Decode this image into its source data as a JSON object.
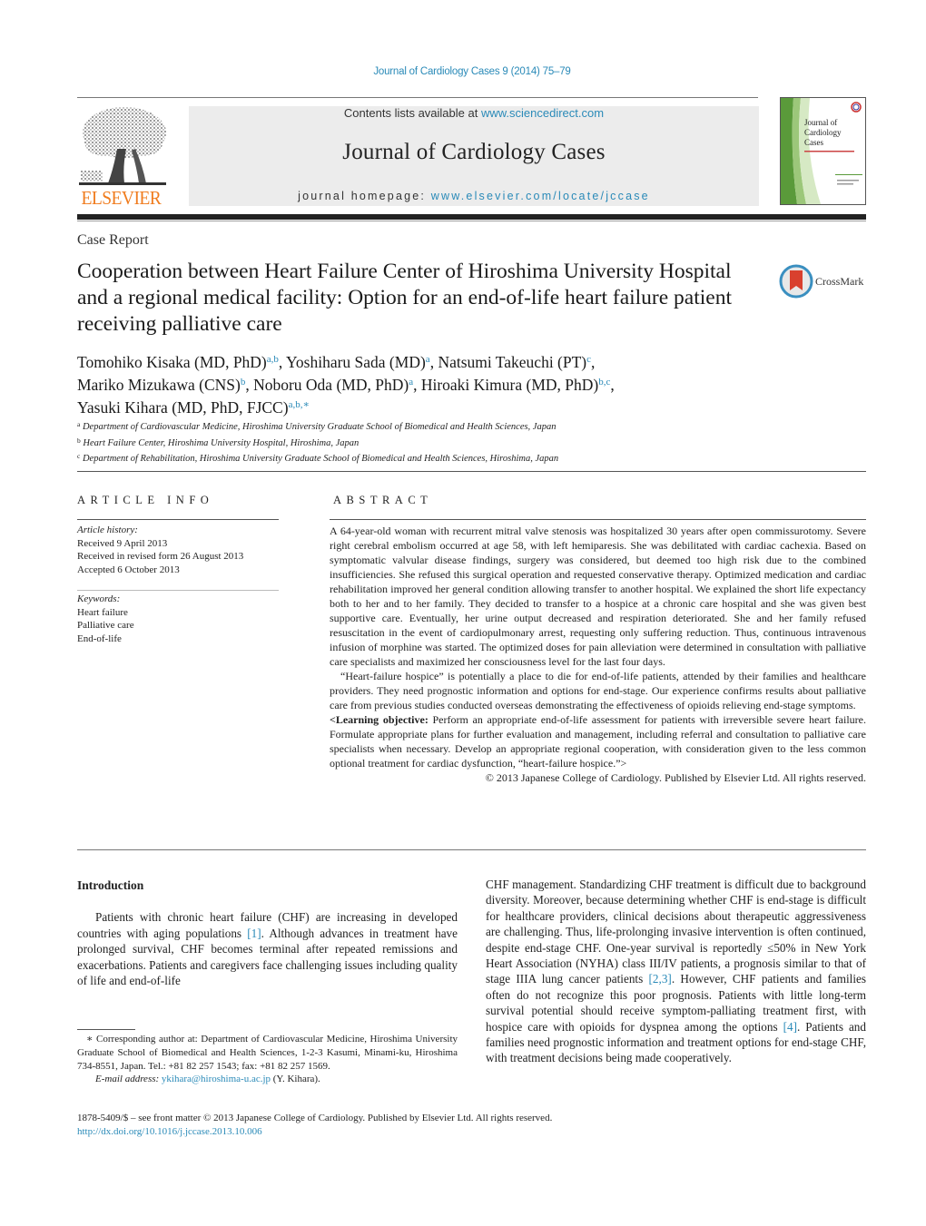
{
  "header": {
    "running_head": "Journal of Cardiology Cases 9 (2014) 75–79",
    "contents_prefix": "Contents lists available at ",
    "contents_link": "www.sciencedirect.com",
    "journal_title": "Journal of Cardiology Cases",
    "homepage_prefix": "journal homepage: ",
    "homepage_link": "www.elsevier.com/locate/jccase",
    "publisher_logo": "ELSEVIER",
    "cover": {
      "line1": "Journal of",
      "line2": "Cardiology",
      "line3": "Cases"
    },
    "colors": {
      "link": "#2a8ab8",
      "elsevier_orange": "#f07c1e",
      "banner_bg": "#ececec"
    }
  },
  "article": {
    "type": "Case Report",
    "title": "Cooperation between Heart Failure Center of Hiroshima University Hospital and a regional medical facility: Option for an end-of-life heart failure patient receiving palliative care",
    "crossmark_label": "CrossMark",
    "authors": [
      {
        "name": "Tomohiko Kisaka (MD, PhD)",
        "sup": "a,b",
        "sep": ", "
      },
      {
        "name": "Yoshiharu Sada (MD)",
        "sup": "a",
        "sep": ", "
      },
      {
        "name": "Natsumi Takeuchi (PT)",
        "sup": "c",
        "sep": ","
      },
      {
        "name": "Mariko Mizukawa (CNS)",
        "sup": "b",
        "sep": ", "
      },
      {
        "name": "Noboru Oda (MD, PhD)",
        "sup": "a",
        "sep": ", "
      },
      {
        "name": "Hiroaki Kimura (MD, PhD)",
        "sup": "b,c",
        "sep": ","
      },
      {
        "name": "Yasuki Kihara (MD, PhD, FJCC)",
        "sup": "a,b,∗",
        "sep": ""
      }
    ],
    "affiliations": [
      {
        "key": "a",
        "text": "Department of Cardiovascular Medicine, Hiroshima University Graduate School of Biomedical and Health Sciences, Japan"
      },
      {
        "key": "b",
        "text": "Heart Failure Center, Hiroshima University Hospital, Hiroshima, Japan"
      },
      {
        "key": "c",
        "text": "Department of Rehabilitation, Hiroshima University Graduate School of Biomedical and Health Sciences, Hiroshima, Japan"
      }
    ]
  },
  "article_info": {
    "heading": "ARTICLE INFO",
    "history_label": "Article history:",
    "received": "Received 9 April 2013",
    "revised": "Received in revised form 26 August 2013",
    "accepted": "Accepted 6 October 2013",
    "keywords_label": "Keywords:",
    "keywords": [
      "Heart failure",
      "Palliative care",
      "End-of-life"
    ]
  },
  "abstract": {
    "heading": "ABSTRACT",
    "p1": "A 64-year-old woman with recurrent mitral valve stenosis was hospitalized 30 years after open commissurotomy. Severe right cerebral embolism occurred at age 58, with left hemiparesis. She was debilitated with cardiac cachexia. Based on symptomatic valvular disease findings, surgery was considered, but deemed too high risk due to the combined insufficiencies. She refused this surgical operation and requested conservative therapy. Optimized medication and cardiac rehabilitation improved her general condition allowing transfer to another hospital. We explained the short life expectancy both to her and to her family. They decided to transfer to a hospice at a chronic care hospital and she was given best supportive care. Eventually, her urine output decreased and respiration deteriorated. She and her family refused resuscitation in the event of cardiopulmonary arrest, requesting only suffering reduction. Thus, continuous intravenous infusion of morphine was started. The optimized doses for pain alleviation were determined in consultation with palliative care specialists and maximized her consciousness level for the last four days.",
    "p2": "“Heart-failure hospice” is potentially a place to die for end-of-life patients, attended by their families and healthcare providers. They need prognostic information and options for end-stage. Our experience confirms results about palliative care from previous studies conducted overseas demonstrating the effectiveness of opioids relieving end-stage symptoms.",
    "lo_label": "<Learning objective:",
    "lo_text": " Perform an appropriate end-of-life assessment for patients with irreversible severe heart failure. Formulate appropriate plans for further evaluation and management, including referral and consultation to palliative care specialists when necessary. Develop an appropriate regional cooperation, with consideration given to the less common optional treatment for cardiac dysfunction, “heart-failure hospice.”>",
    "copyright": "© 2013 Japanese College of Cardiology. Published by Elsevier Ltd. All rights reserved."
  },
  "body": {
    "intro_heading": "Introduction",
    "left_p1_a": "Patients with chronic heart failure (CHF) are increasing in developed countries with aging populations ",
    "ref1": "[1]",
    "left_p1_b": ". Although advances in treatment have prolonged survival, CHF becomes terminal after repeated remissions and exacerbations. Patients and caregivers face challenging issues including quality of life and end-of-life",
    "right_a": "CHF management. Standardizing CHF treatment is difficult due to background diversity. Moreover, because determining whether CHF is end-stage is difficult for healthcare providers, clinical decisions about therapeutic aggressiveness are challenging. Thus, life-prolonging invasive intervention is often continued, despite end-stage CHF. One-year survival is reportedly ≤50% in New York Heart Association (NYHA) class III/IV patients, a prognosis similar to that of stage IIIA lung cancer patients ",
    "ref23": "[2,3]",
    "right_b": ". However, CHF patients and families often do not recognize this poor prognosis. Patients with little long-term survival potential should receive symptom-palliating treatment first, with hospice care with opioids for dyspnea among the options ",
    "ref4": "[4]",
    "right_c": ". Patients and families need prognostic information and treatment options for end-stage CHF, with treatment decisions being made cooperatively."
  },
  "footnote": {
    "corresponding": "∗ Corresponding author at: Department of Cardiovascular Medicine, Hiroshima University Graduate School of Biomedical and Health Sciences, 1-2-3 Kasumi, Minami-ku, Hiroshima 734-8551, Japan. Tel.: +81 82 257 1543; fax: +81 82 257 1569.",
    "email_label": "E-mail address:",
    "email": "ykihara@hiroshima-u.ac.jp",
    "email_suffix": " (Y. Kihara)."
  },
  "bottom": {
    "issn_line": "1878-5409/$ – see front matter © 2013 Japanese College of Cardiology. Published by Elsevier Ltd. All rights reserved.",
    "doi": "http://dx.doi.org/10.1016/j.jccase.2013.10.006"
  }
}
